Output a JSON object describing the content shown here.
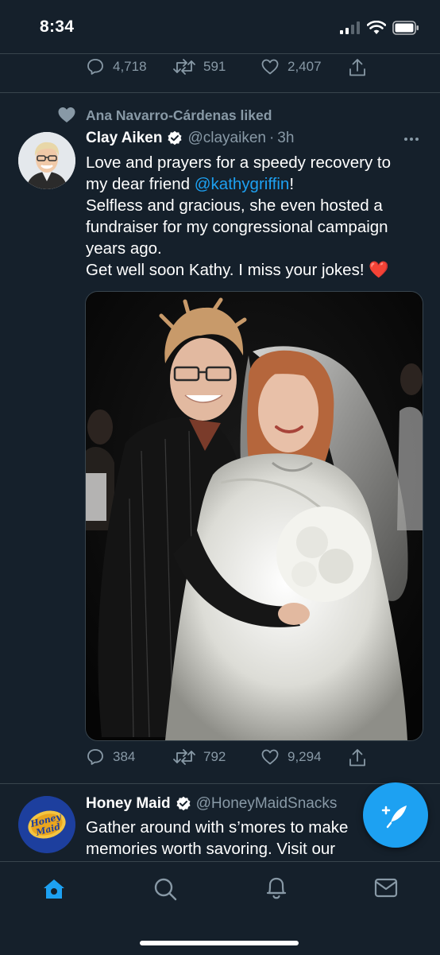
{
  "status_bar": {
    "time": "8:34"
  },
  "prev_tweet": {
    "replies": "4,718",
    "retweets": "591",
    "likes": "2,407"
  },
  "liked_tweet": {
    "context": "Ana Navarro-Cárdenas liked",
    "author_name": "Clay Aiken",
    "author_handle": "@clayaiken",
    "separator": "·",
    "time": "3h",
    "text_line1": "Love and prayers for a speedy recovery to",
    "text_line2_prefix": "my dear friend ",
    "mention": "@kathygriffin",
    "text_line2_suffix": "!",
    "text_line3": "Selfless and gracious, she even hosted a",
    "text_line4": "fundraiser for my congressional campaign",
    "text_line5": "years ago.",
    "text_line6": "Get well soon Kathy. I miss your jokes! ❤️",
    "replies": "384",
    "retweets": "792",
    "likes": "9,294"
  },
  "next_tweet": {
    "author_name": "Honey Maid",
    "author_handle": "@HoneyMaidSnacks",
    "text_line1": "Gather around with s’mores to make",
    "text_line2": "memories worth savoring. Visit our",
    "avatar_text_top": "Honey",
    "avatar_text_bottom": "Maid"
  },
  "colors": {
    "background": "#15202b",
    "accent": "#1da1f2",
    "muted": "#8899a6",
    "divider": "#38444d",
    "like_heart": "#e0245e"
  },
  "nav": [
    "home-icon",
    "search-icon",
    "notifications-icon",
    "messages-icon"
  ]
}
